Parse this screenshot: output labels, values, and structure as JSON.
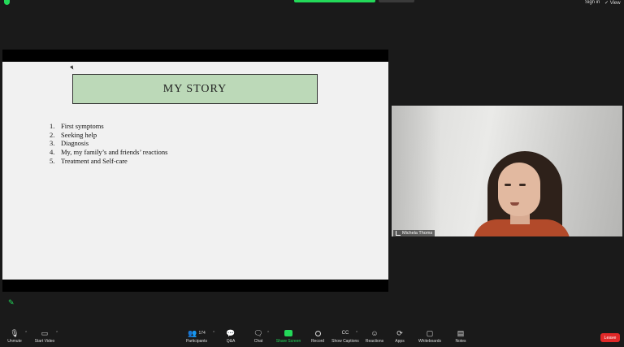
{
  "topbar": {
    "sign_in": "Sign in",
    "view": "View"
  },
  "slide": {
    "title": "MY STORY",
    "items": [
      {
        "num": "1.",
        "text": "First symptoms"
      },
      {
        "num": "2.",
        "text": "Seeking help"
      },
      {
        "num": "3.",
        "text": "Diagnosis"
      },
      {
        "num": "4.",
        "text": "My, my family’s and friends’ reactions"
      },
      {
        "num": "5.",
        "text": "Treatment and Self-care"
      }
    ]
  },
  "video": {
    "participant_name": "Michela Thoms"
  },
  "toolbar": {
    "unmute": "Unmute",
    "start_video": "Start Video",
    "participants": "Participants",
    "participants_count": "174",
    "qa": "Q&A",
    "chat": "Chat",
    "share_screen": "Share Screen",
    "record": "Record",
    "show_captions": "Show Captions",
    "reactions": "Reactions",
    "apps": "Apps",
    "whiteboards": "Whiteboards",
    "notes": "Notes",
    "leave": "Leave"
  },
  "colors": {
    "accent_green": "#23d959",
    "leave_red": "#e02828",
    "title_box": "#bcd9b8"
  }
}
